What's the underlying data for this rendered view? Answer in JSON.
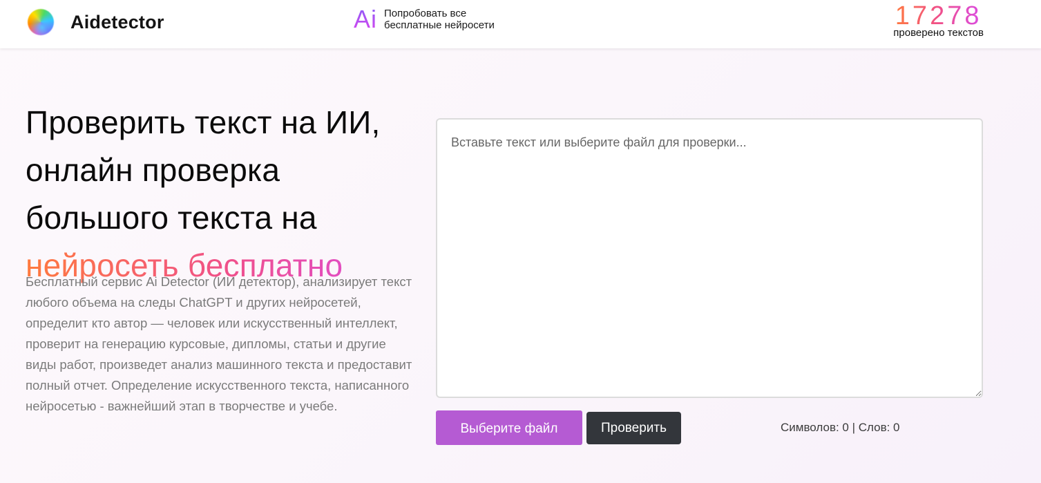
{
  "header": {
    "brand_name": "Aidetector",
    "ai_mark": "Ai",
    "ai_line1": "Попробовать все",
    "ai_line2": "бесплатные нейросети",
    "counter_value": "17278",
    "counter_label": "проверено текстов"
  },
  "hero": {
    "title_line1": "Проверить текст на ИИ,",
    "title_line2": "онлайн проверка",
    "title_line3": "большого текста на",
    "title_accent": "нейросеть бесплатно",
    "description": "Бесплатный сервис Ai Detector (ИИ детектор), анализирует текст любого объема на следы ChatGPT и других нейросетей, определит кто автор — человек или искусственный интеллект, проверит на генерацию курсовые, дипломы, статьи и другие виды работ, произведет анализ машинного текста и предоставит полный отчет. Определение искусственного текста, написанного нейросетью - важнейший этап в творчестве и учебе."
  },
  "checker": {
    "textarea_value": "",
    "textarea_placeholder": "Вставьте текст или выберите файл для проверки...",
    "file_button_label": "Выберите файл",
    "check_button_label": "Проверить",
    "stats_text": "Символов: 0 | Слов: 0"
  },
  "colors": {
    "accent_start": "#ff7a3d",
    "accent_mid": "#f0508a",
    "accent_end": "#d94ce6",
    "file_button": "#b55bd3",
    "check_button": "#33363b"
  },
  "icons": {
    "brand_logo": "gradient-orb-logo"
  }
}
